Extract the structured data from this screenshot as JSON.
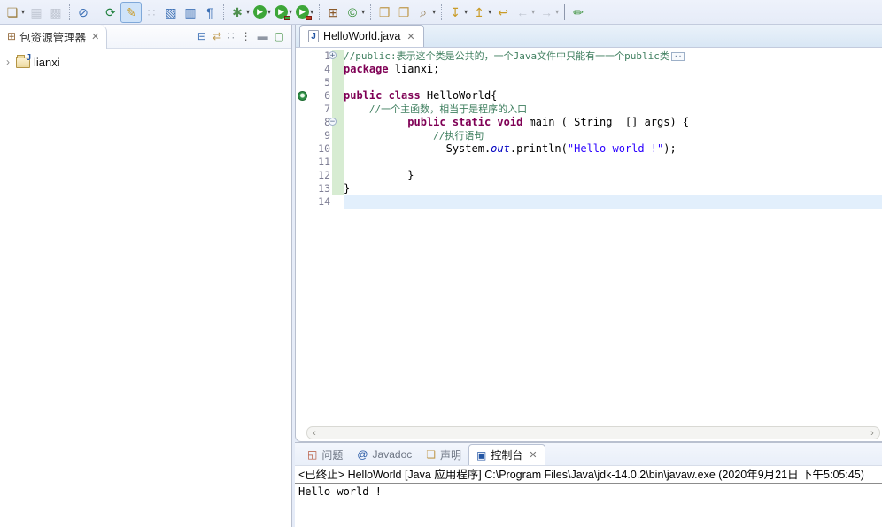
{
  "colors": {
    "keyword": "#7f0055",
    "comment": "#3f7f5f",
    "string": "#2a00ff",
    "field": "#0000c0",
    "current_line": "#e2effc",
    "change_bar": "#d7ecd2",
    "toolbar_bg": "#e9eef9",
    "run_green": "#3da639"
  },
  "toolbar": {
    "items": [
      {
        "name": "new-wizard",
        "glyph": "❏",
        "color": "#9a7b3a",
        "dropdown": true
      },
      {
        "name": "save",
        "glyph": "▦",
        "color": "#8f96a3",
        "disabled": true
      },
      {
        "name": "save-all",
        "glyph": "▩",
        "color": "#8f96a3",
        "disabled": true
      },
      {
        "sep": true
      },
      {
        "name": "skip-breakpoints",
        "glyph": "⊘",
        "color": "#3b6fb5"
      },
      {
        "sep": true
      },
      {
        "name": "relaunch",
        "glyph": "⟳",
        "color": "#21813f"
      },
      {
        "name": "mark-occurrences",
        "glyph": "✎",
        "color": "#c99b27",
        "active": true
      },
      {
        "name": "team-presence",
        "glyph": "∷",
        "color": "#8f96a3",
        "disabled": true
      },
      {
        "name": "open-type",
        "glyph": "▧",
        "color": "#3b6fb5"
      },
      {
        "name": "block-selection",
        "glyph": "▥",
        "color": "#3b6fb5"
      },
      {
        "name": "show-whitespace",
        "glyph": "¶",
        "color": "#3b6fb5"
      },
      {
        "sep": true
      },
      {
        "name": "debug",
        "glyph": "✱",
        "color": "#4e8f4e",
        "dropdown": true
      },
      {
        "name": "run",
        "glyph": "▶",
        "circle": "#3da639",
        "dropdown": true
      },
      {
        "name": "coverage",
        "glyph": "▶",
        "circle": "#3da639",
        "badge": "#3da639",
        "dropdown": true
      },
      {
        "name": "external-tools",
        "glyph": "▶",
        "circle": "#3da639",
        "badge": "#c23b22",
        "dropdown": true
      },
      {
        "sep": true
      },
      {
        "name": "new-java-project",
        "glyph": "⊞",
        "color": "#8b5a2b"
      },
      {
        "name": "new-class",
        "glyph": "©",
        "color": "#2e8b2e",
        "dropdown": true
      },
      {
        "sep": true
      },
      {
        "name": "open-task",
        "glyph": "❒",
        "color": "#c09a4e"
      },
      {
        "name": "open-resource",
        "glyph": "❐",
        "color": "#c09a4e"
      },
      {
        "name": "search",
        "glyph": "⌕",
        "color": "#8a6d3b",
        "dropdown": true
      },
      {
        "sep": true
      },
      {
        "name": "next-annotation",
        "glyph": "↧",
        "color": "#c99b27",
        "dropdown": true
      },
      {
        "name": "previous-annotation",
        "glyph": "↥",
        "color": "#c99b27",
        "dropdown": true
      },
      {
        "name": "last-edit-location",
        "glyph": "↩",
        "color": "#c99b27"
      },
      {
        "name": "back",
        "glyph": "←",
        "color": "#8f96a3",
        "dropdown": true,
        "disabled": true
      },
      {
        "name": "forward",
        "glyph": "→",
        "color": "#8f96a3",
        "dropdown": true,
        "disabled": true
      },
      {
        "sep": true,
        "thick": true
      },
      {
        "name": "perspective-java",
        "glyph": "✏",
        "color": "#2e8b2e"
      }
    ]
  },
  "explorer": {
    "tab_label": "包资源管理器",
    "tab_close": "✕",
    "tab_icon": "⊞",
    "tools": [
      {
        "name": "collapse-all",
        "glyph": "⊟",
        "color": "#3b6fb5"
      },
      {
        "name": "link-with-editor",
        "glyph": "⇄",
        "color": "#c09a4e"
      },
      {
        "name": "focus-task",
        "glyph": "∷",
        "color": "#9aa0aa"
      },
      {
        "name": "view-menu",
        "glyph": "⋮",
        "color": "#666666"
      },
      {
        "name": "minimize",
        "glyph": "▬",
        "color": "#8f96a3"
      },
      {
        "name": "maximize",
        "glyph": "▢",
        "color": "#5b9e5b"
      }
    ],
    "tree": [
      {
        "label": "lianxi",
        "twisty": "›",
        "icon_letter": "J"
      }
    ]
  },
  "editor": {
    "tab_label": "HelloWorld.java",
    "tab_close": "✕",
    "tab_icon_letter": "J",
    "scroll_left": "‹",
    "scroll_right": "›",
    "lines": [
      {
        "num": "1",
        "fold": "+",
        "changed": true,
        "foldbox": "··",
        "segs": [
          {
            "c": "comment",
            "t": "//public:表示这个类是公共的，一个Java文件中只能有一一个public类"
          }
        ]
      },
      {
        "num": "4",
        "changed": true,
        "segs": [
          {
            "c": "kw",
            "t": "package"
          },
          {
            "c": "plain",
            "t": " lianxi;"
          }
        ]
      },
      {
        "num": "5",
        "changed": true,
        "segs": []
      },
      {
        "num": "6",
        "changed": true,
        "marker": true,
        "segs": [
          {
            "c": "kw",
            "t": "public class"
          },
          {
            "c": "plain",
            "t": " HelloWorld{"
          }
        ]
      },
      {
        "num": "7",
        "changed": true,
        "segs": [
          {
            "c": "plain",
            "t": "    "
          },
          {
            "c": "comment",
            "t": "//一个主函数，相当于是程序的入口"
          }
        ]
      },
      {
        "num": "8",
        "fold": "−",
        "changed": true,
        "segs": [
          {
            "c": "plain",
            "t": "          "
          },
          {
            "c": "kw",
            "t": "public static void"
          },
          {
            "c": "plain",
            "t": " main ( String  [] args) {"
          }
        ]
      },
      {
        "num": "9",
        "changed": true,
        "segs": [
          {
            "c": "plain",
            "t": "              "
          },
          {
            "c": "comment",
            "t": "//执行语句"
          }
        ]
      },
      {
        "num": "10",
        "changed": true,
        "segs": [
          {
            "c": "plain",
            "t": "                System."
          },
          {
            "c": "field",
            "t": "out"
          },
          {
            "c": "plain",
            "t": ".println("
          },
          {
            "c": "str",
            "t": "\"Hello world !\""
          },
          {
            "c": "plain",
            "t": ");"
          }
        ]
      },
      {
        "num": "11",
        "changed": true,
        "segs": []
      },
      {
        "num": "12",
        "changed": true,
        "segs": [
          {
            "c": "plain",
            "t": "          }"
          }
        ]
      },
      {
        "num": "13",
        "changed": true,
        "segs": [
          {
            "c": "plain",
            "t": "}"
          }
        ]
      },
      {
        "num": "14",
        "current": true,
        "segs": []
      }
    ]
  },
  "console": {
    "tabs": [
      {
        "name": "problems",
        "label": "问题",
        "icon": "◱",
        "icon_color": "#b5543a"
      },
      {
        "name": "javadoc",
        "label": "Javadoc",
        "icon": "@",
        "icon_color": "#2456a4"
      },
      {
        "name": "declaration",
        "label": "声明",
        "icon": "❏",
        "icon_color": "#c09a4e"
      },
      {
        "name": "console",
        "label": "控制台",
        "icon": "▣",
        "icon_color": "#2456a4",
        "active": true,
        "close": "✕"
      }
    ],
    "title": "<已终止> HelloWorld [Java 应用程序] C:\\Program Files\\Java\\jdk-14.0.2\\bin\\javaw.exe  (2020年9月21日 下午5:05:45)",
    "output": "Hello world !"
  }
}
